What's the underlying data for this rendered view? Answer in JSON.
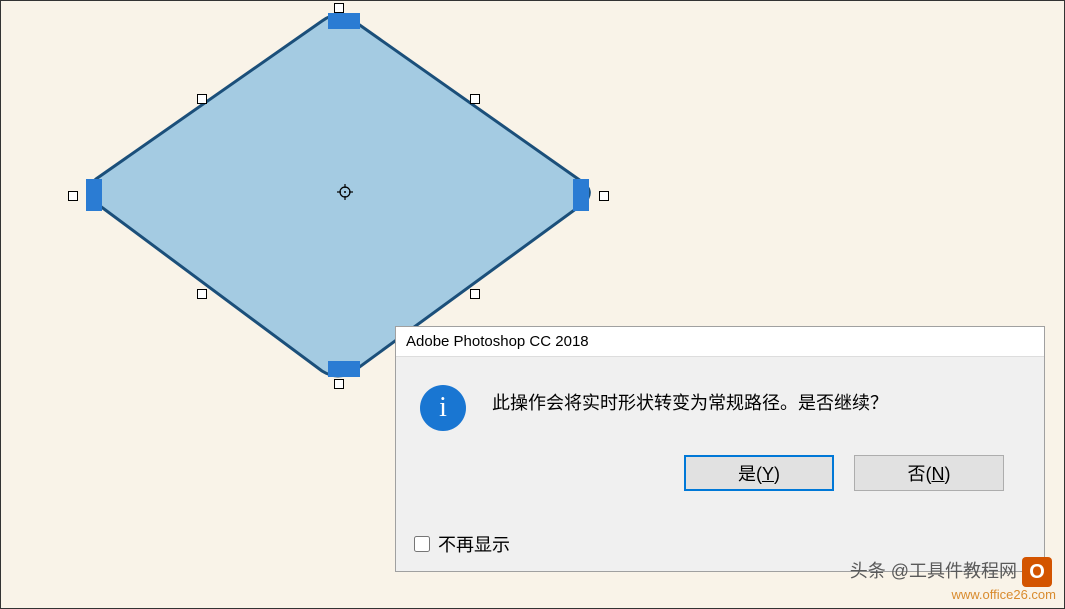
{
  "dialog": {
    "title": "Adobe Photoshop CC 2018",
    "message": "此操作会将实时形状转变为常规路径。是否继续？",
    "yes_label": "是(Y)",
    "no_label": "否(N)",
    "dont_show_label": "不再显示"
  },
  "watermark": {
    "line1": "头条 @工具件教程网",
    "line2": "www.office26.com"
  },
  "shape": {
    "fill": "#a4cbe2",
    "stroke": "#1b4f7a"
  }
}
